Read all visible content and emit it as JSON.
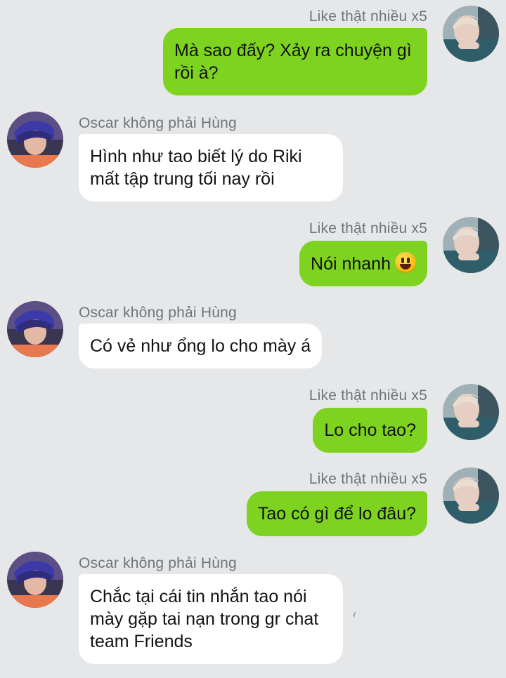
{
  "messages": [
    {
      "direction": "out",
      "sender": "Like thật nhiều x5",
      "lines": [
        "Mà sao đấy? Xảy ra chuyện gì",
        "rồi à?"
      ]
    },
    {
      "direction": "in",
      "sender": "Oscar không phải Hùng",
      "lines": [
        "Hình như tao biết lý do Riki",
        "mất tập trung tối nay rồi"
      ]
    },
    {
      "direction": "out",
      "sender": "Like thật nhiều x5",
      "lines": [
        "Nói nhanh"
      ],
      "emoji": "grinning-face-emoji"
    },
    {
      "direction": "in",
      "sender": "Oscar không phải Hùng",
      "lines": [
        "Có vẻ như ổng lo cho mày á"
      ]
    },
    {
      "direction": "out",
      "sender": "Like thật nhiều x5",
      "lines": [
        "Lo cho tao?"
      ]
    },
    {
      "direction": "out",
      "sender": "Like thật nhiều x5",
      "lines": [
        "Tao có gì để lo đâu?"
      ]
    },
    {
      "direction": "in",
      "sender": "Oscar không phải Hùng",
      "lines": [
        "Chắc tại cái tin nhắn tao nói",
        "mày gặp tai nạn trong gr chat",
        "team Friends"
      ]
    }
  ],
  "colors": {
    "background": "#e6e7e9",
    "outgoing_bubble": "#7ed321",
    "incoming_bubble": "#ffffff",
    "sender_name": "#707478",
    "message_text": "#121212"
  }
}
